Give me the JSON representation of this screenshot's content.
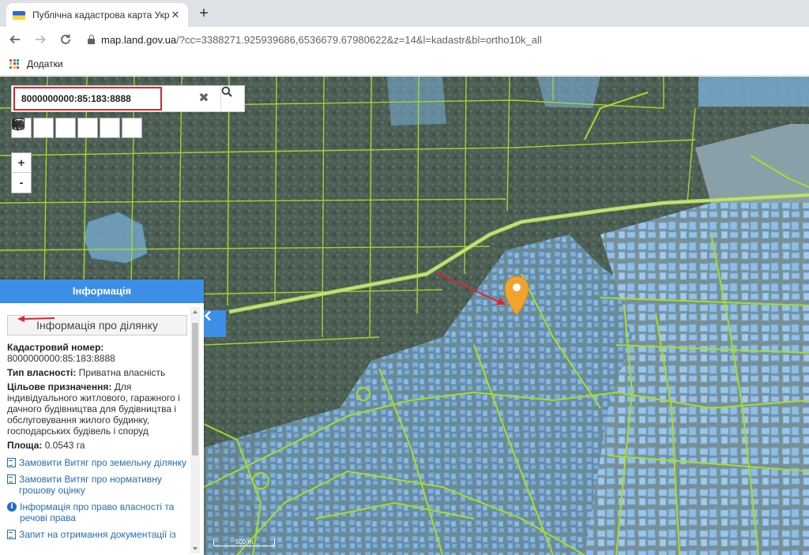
{
  "browser": {
    "tab_title": "Публічна кадастрова карта Укр",
    "tab_close": "✕",
    "new_tab": "+",
    "url_host": "map.land.gov.ua",
    "url_rest": "/?cc=3388271.925939686,6536679.67980622&z=14&l=kadastr&bl=ortho10k_all",
    "bookmarks_label": "Додатки",
    "apps_colors": [
      "#ea4335",
      "#4285f4",
      "#34a853",
      "#fbbc05",
      "#ea4335",
      "#4285f4",
      "#34a853",
      "#fbbc05",
      "#ea4335"
    ]
  },
  "map": {
    "search_value": "8000000000:85:183:8888",
    "zoom_in": "+",
    "zoom_out": "-",
    "tools": [
      "print-icon",
      "measure-length-icon",
      "measure-area-icon",
      "select-cursor-icon",
      "identify-icon",
      "route-icon"
    ],
    "scale_label": "500 m",
    "colors": {
      "panel_header": "#3d8ee7",
      "parcel_fill": "#74b4ec",
      "boundary_line": "#a8dc2c",
      "annotation_red": "#e3242b",
      "marker": "#f0a331"
    }
  },
  "panel": {
    "header": "Інформація",
    "section_title": "Інформація про ділянку",
    "cadastral_label": "Кадастровий номер:",
    "cadastral_value": "8000000000:85:183:8888",
    "ownership_label": "Тип власності:",
    "ownership_value": "Приватна власність",
    "purpose_label": "Цільове призначення:",
    "purpose_value": "Для індивідуального житлового, гаражного і дачного будівництва для будівництва і обслуговування жилого будинку, господарських будівель і споруд",
    "area_label": "Площа:",
    "area_value": "0.0543 га",
    "links": [
      {
        "text": "Замовити Витяг про земельну ділянку",
        "icon": "document-icon"
      },
      {
        "text": "Замовити Витяг про нормативну грошову оцінку",
        "icon": "document-icon"
      },
      {
        "text": "Інформація про право власності та речові права",
        "icon": "info-icon"
      },
      {
        "text": "Запит на отримання документації із",
        "icon": "document-icon"
      }
    ]
  }
}
